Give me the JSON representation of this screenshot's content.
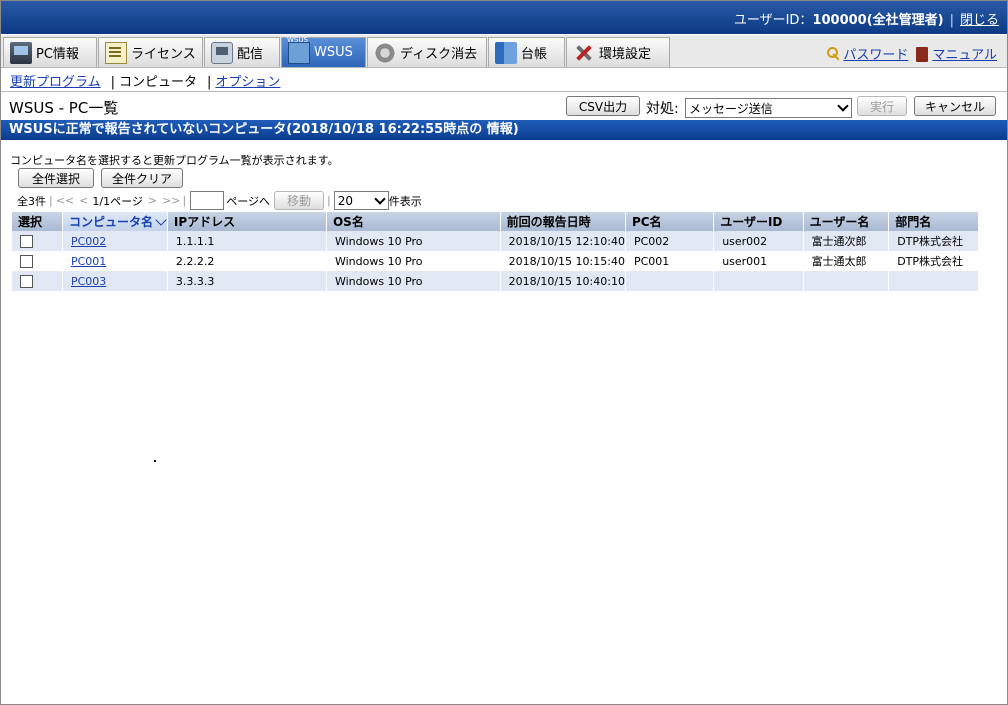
{
  "header": {
    "user_label": "ユーザーID：",
    "user_value": "100000(全社管理者)",
    "separator": "|",
    "close_link": "閉じる"
  },
  "tabs": [
    {
      "label": "PC情報",
      "icon": "pc-icon"
    },
    {
      "label": "ライセンス",
      "icon": "license-icon"
    },
    {
      "label": "配信",
      "icon": "distribution-icon"
    },
    {
      "label": "WSUS",
      "icon": "wsus-icon",
      "active": true
    },
    {
      "label": "ディスク消去",
      "icon": "disk-erase-icon"
    },
    {
      "label": "台帳",
      "icon": "ledger-icon"
    },
    {
      "label": "環境設定",
      "icon": "settings-tools-icon"
    }
  ],
  "rightlinks": {
    "password": "パスワード",
    "manual": "マニュアル"
  },
  "subnav": {
    "updates": "更新プログラム",
    "computer": "コンピュータ",
    "option": "オプション",
    "bar": "|"
  },
  "page_title": "WSUS - PC一覧",
  "toolbar": {
    "csv": "CSV出力",
    "action_label": "対処:",
    "action_value": "メッセージ送信",
    "run": "実行",
    "cancel": "キャンセル"
  },
  "banner": "WSUSに正常で報告されていないコンピュータ(2018/10/18 16:22:55時点の 情報)",
  "description": "コンピュータ名を選択すると更新プログラム一覧が表示されます。",
  "buttons": {
    "select_all": "全件選択",
    "clear_all": "全件クリア"
  },
  "pager": {
    "total": "全3件",
    "first": "<<",
    "prev": "<",
    "page_info": "1/1ページ",
    "next": ">",
    "last": ">>",
    "goto_suffix": "ページへ",
    "move": "移動",
    "per_page": "20",
    "per_page_suffix": "件表示"
  },
  "table": {
    "columns": [
      "選択",
      "コンピュータ名",
      "IPアドレス",
      "OS名",
      "前回の報告日時",
      "PC名",
      "ユーザーID",
      "ユーザー名",
      "部門名"
    ],
    "rows": [
      {
        "name": "PC002",
        "ip": "1.1.1.1",
        "os": "Windows 10 Pro",
        "last": "2018/10/15 12:10:40",
        "pc": "PC002",
        "uid": "user002",
        "uname": "富士通次郎",
        "dept": "DTP株式会社"
      },
      {
        "name": "PC001",
        "ip": "2.2.2.2",
        "os": "Windows 10 Pro",
        "last": "2018/10/15 10:15:40",
        "pc": "PC001",
        "uid": "user001",
        "uname": "富士通太郎",
        "dept": "DTP株式会社"
      },
      {
        "name": "PC003",
        "ip": "3.3.3.3",
        "os": "Windows 10 Pro",
        "last": "2018/10/15 10:40:10",
        "pc": "",
        "uid": "",
        "uname": "",
        "dept": ""
      }
    ]
  }
}
